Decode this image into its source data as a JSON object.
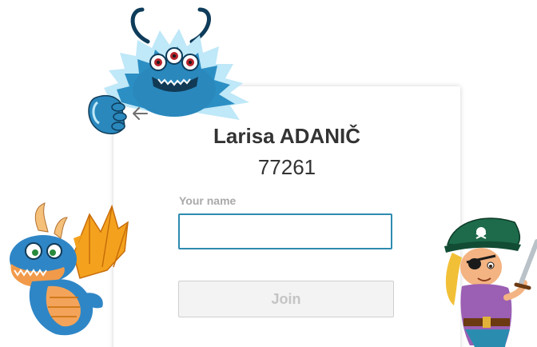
{
  "card": {
    "teacher_name": "Larisa ADANIČ",
    "class_code": "77261",
    "name_label": "Your name",
    "name_value": "",
    "join_label": "Join"
  },
  "icons": {
    "back": "arrow-left-icon"
  },
  "colors": {
    "input_border": "#2e8bb0",
    "join_bg": "#f3f3f3",
    "join_text": "#c4c4c4",
    "label": "#a9a9a9",
    "title": "#333333"
  }
}
